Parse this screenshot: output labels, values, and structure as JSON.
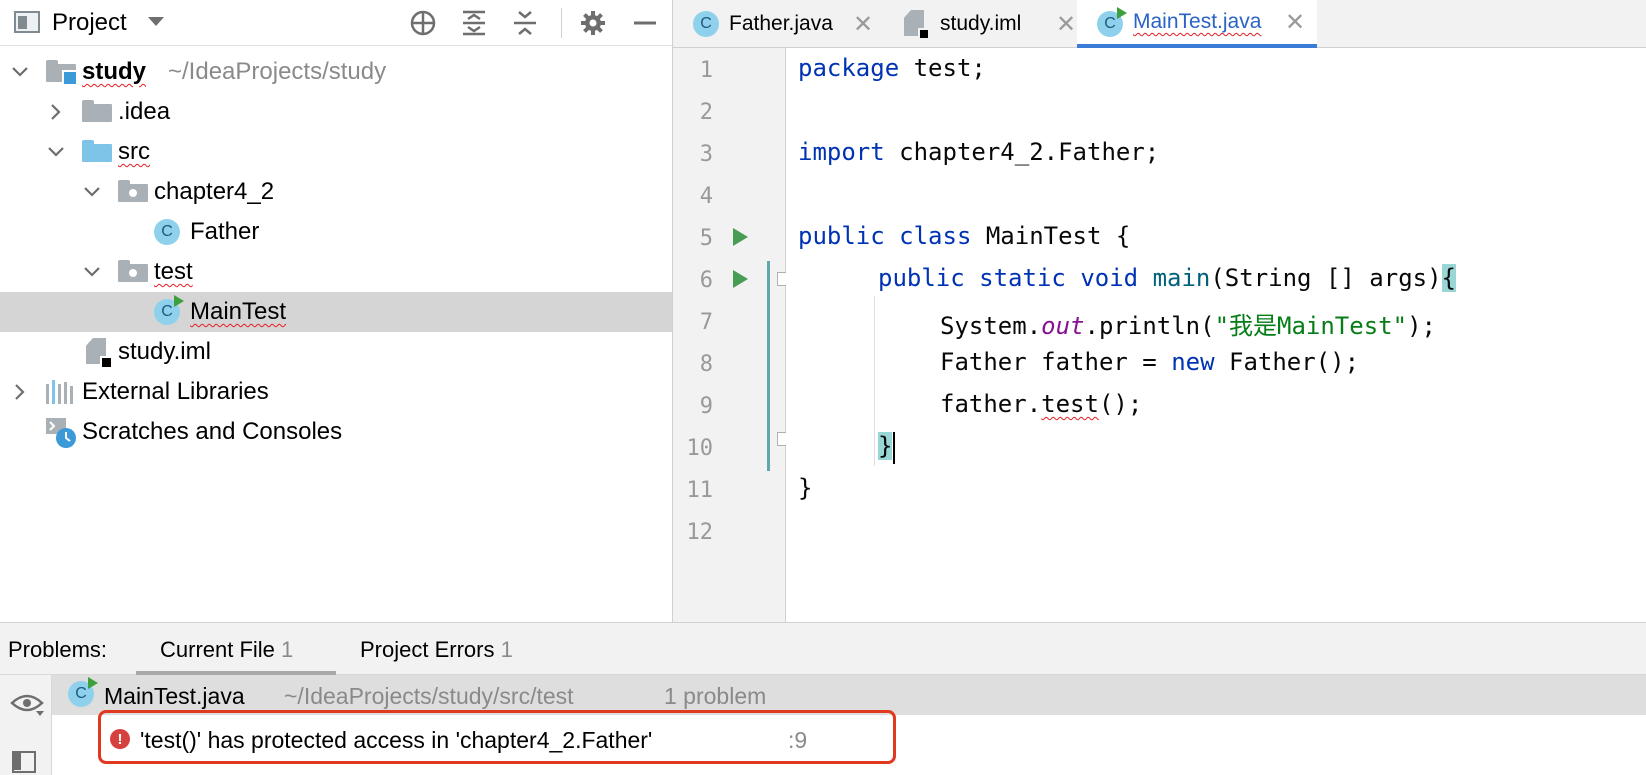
{
  "sidebar": {
    "title": "Project",
    "tree": [
      {
        "name": "study",
        "path": "~/IdeaProjects/study"
      },
      {
        "name": ".idea"
      },
      {
        "name": "src"
      },
      {
        "name": "chapter4_2"
      },
      {
        "name": "Father"
      },
      {
        "name": "test"
      },
      {
        "name": "MainTest"
      },
      {
        "name": "study.iml"
      },
      {
        "name": "External Libraries"
      },
      {
        "name": "Scratches and Consoles"
      }
    ]
  },
  "tabs": [
    {
      "label": "Father.java",
      "icon": "class-icon"
    },
    {
      "label": "study.iml",
      "icon": "iml-file-icon"
    },
    {
      "label": "MainTest.java",
      "icon": "runnable-class-icon",
      "active": true
    }
  ],
  "editor": {
    "line_numbers": [
      "1",
      "2",
      "3",
      "4",
      "5",
      "6",
      "7",
      "8",
      "9",
      "10",
      "11",
      "12"
    ],
    "current_line": 10,
    "tokens": {
      "l1_kw": "package",
      "l1_rest": " test;",
      "l3_kw": "import",
      "l3_rest": " chapter4_2.Father;",
      "l5_kw1": "public",
      "l5_kw2": "class",
      "l5_rest": " MainTest {",
      "l6_kw1": "public",
      "l6_kw2": "static",
      "l6_kw3": "void",
      "l6_fn": "main",
      "l6_rest": "(String [] args)",
      "l6_brace": "{",
      "l7_a": "System.",
      "l7_fld": "out",
      "l7_b": ".println(",
      "l7_str": "\"我是MainTest\"",
      "l7_c": ");",
      "l8_a": "Father father = ",
      "l8_kw": "new",
      "l8_b": " Father();",
      "l9_a": "father.",
      "l9_err": "test",
      "l9_b": "();",
      "l10": "}",
      "l11": "}"
    }
  },
  "problems": {
    "label": "Problems:",
    "tabs": [
      {
        "label": "Current File",
        "count": "1"
      },
      {
        "label": "Project Errors",
        "count": "1"
      }
    ],
    "file": "MainTest.java",
    "file_path": "~/IdeaProjects/study/src/test",
    "file_count": "1 problem",
    "error_text": "'test()' has protected access in 'chapter4_2.Father'",
    "error_line": ":9"
  },
  "colors": {
    "accent": "#3c7cd9",
    "error": "#e0391d",
    "folder_blue": "#7ec4e8",
    "folder_grey": "#a9b1b6"
  }
}
